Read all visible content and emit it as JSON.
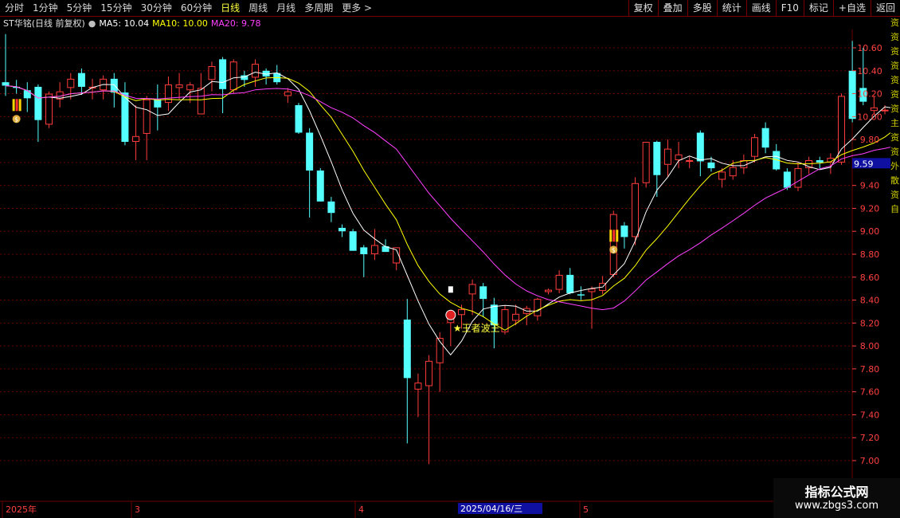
{
  "toolbar": {
    "left_items": [
      "分时",
      "1分钟",
      "5分钟",
      "15分钟",
      "30分钟",
      "60分钟",
      "日线",
      "周线",
      "月线",
      "多周期",
      "更多 >"
    ],
    "active_item": "日线",
    "right_items": [
      "复权",
      "叠加",
      "多股",
      "统计",
      "画线",
      "F10",
      "标记",
      "+自选",
      "返回"
    ]
  },
  "info": {
    "title": "ST华铭(日线 前复权)",
    "ma5": "MA5: 10.04",
    "ma10": "MA10: 10.00",
    "ma20": "MA20: 9.78"
  },
  "colors": {
    "up": "#ff3c3c",
    "down": "#54ffff",
    "ma5": "#ffffff",
    "ma10": "#ffff00",
    "ma20": "#ff40ff",
    "grid": "#6a0000",
    "axis_text": "#ff4040",
    "price_box": "#1010a0"
  },
  "price_axis": {
    "ticks": [
      "10.60",
      "10.40",
      "10.20",
      "10.00",
      "9.80",
      "9.60",
      "9.40",
      "9.20",
      "9.00",
      "8.80",
      "8.60",
      "8.40",
      "8.20",
      "8.00",
      "7.80",
      "7.60",
      "7.40",
      "7.20",
      "7.00"
    ],
    "current_price": "9.59"
  },
  "date_axis": {
    "labels": [
      "2025年",
      "3",
      "4",
      "5"
    ],
    "cursor_date": "2025/04/16/三"
  },
  "annotations": {
    "signal_text": "★王者波王"
  },
  "side_labels": [
    "资",
    "资",
    "资",
    "资",
    "资",
    "资",
    "资",
    "主",
    "资",
    "资",
    "外",
    "散",
    "资",
    "自"
  ],
  "watermark": {
    "line1": "指标公式网",
    "line2": "www.zbgs3.com"
  },
  "chart_data": {
    "type": "candlestick",
    "ylim": [
      6.92,
      10.95
    ],
    "candles": [
      {
        "o": 10.3,
        "h": 10.72,
        "l": 10.18,
        "c": 10.27
      },
      {
        "o": 10.26,
        "h": 10.32,
        "l": 10.2,
        "c": 10.25
      },
      {
        "o": 10.23,
        "h": 10.3,
        "l": 10.04,
        "c": 10.16
      },
      {
        "o": 10.26,
        "h": 10.28,
        "l": 9.78,
        "c": 9.97
      },
      {
        "o": 9.93,
        "h": 10.22,
        "l": 9.9,
        "c": 10.2
      },
      {
        "o": 10.15,
        "h": 10.3,
        "l": 10.08,
        "c": 10.22
      },
      {
        "o": 10.25,
        "h": 10.38,
        "l": 10.15,
        "c": 10.33
      },
      {
        "o": 10.38,
        "h": 10.42,
        "l": 10.19,
        "c": 10.26
      },
      {
        "o": 10.25,
        "h": 10.33,
        "l": 10.15,
        "c": 10.26
      },
      {
        "o": 10.23,
        "h": 10.36,
        "l": 10.15,
        "c": 10.33
      },
      {
        "o": 10.33,
        "h": 10.38,
        "l": 10.08,
        "c": 10.21
      },
      {
        "o": 10.21,
        "h": 10.3,
        "l": 9.75,
        "c": 9.78
      },
      {
        "o": 9.78,
        "h": 10.1,
        "l": 9.62,
        "c": 9.83
      },
      {
        "o": 9.85,
        "h": 10.18,
        "l": 9.62,
        "c": 10.15
      },
      {
        "o": 10.15,
        "h": 10.28,
        "l": 9.88,
        "c": 10.08
      },
      {
        "o": 10.12,
        "h": 10.35,
        "l": 10.05,
        "c": 10.28
      },
      {
        "o": 10.25,
        "h": 10.38,
        "l": 10.15,
        "c": 10.28
      },
      {
        "o": 10.23,
        "h": 10.3,
        "l": 10.12,
        "c": 10.28
      },
      {
        "o": 10.02,
        "h": 10.38,
        "l": 10.02,
        "c": 10.25
      },
      {
        "o": 10.32,
        "h": 10.48,
        "l": 10.22,
        "c": 10.44
      },
      {
        "o": 10.5,
        "h": 10.52,
        "l": 10.03,
        "c": 10.24
      },
      {
        "o": 10.23,
        "h": 10.5,
        "l": 10.2,
        "c": 10.48
      },
      {
        "o": 10.36,
        "h": 10.4,
        "l": 10.26,
        "c": 10.32
      },
      {
        "o": 10.34,
        "h": 10.5,
        "l": 10.26,
        "c": 10.46
      },
      {
        "o": 10.4,
        "h": 10.42,
        "l": 10.28,
        "c": 10.35
      },
      {
        "o": 10.38,
        "h": 10.45,
        "l": 10.28,
        "c": 10.3
      },
      {
        "o": 10.18,
        "h": 10.25,
        "l": 10.12,
        "c": 10.22
      },
      {
        "o": 10.1,
        "h": 10.12,
        "l": 9.85,
        "c": 9.86
      },
      {
        "o": 9.86,
        "h": 9.9,
        "l": 9.12,
        "c": 9.53
      },
      {
        "o": 9.53,
        "h": 9.55,
        "l": 9.26,
        "c": 9.26
      },
      {
        "o": 9.26,
        "h": 9.3,
        "l": 9.08,
        "c": 9.16
      },
      {
        "o": 9.03,
        "h": 9.06,
        "l": 8.95,
        "c": 9.0
      },
      {
        "o": 9.0,
        "h": 9.02,
        "l": 8.83,
        "c": 8.83
      },
      {
        "o": 8.86,
        "h": 8.88,
        "l": 8.6,
        "c": 8.8
      },
      {
        "o": 8.8,
        "h": 9.02,
        "l": 8.75,
        "c": 8.88
      },
      {
        "o": 8.87,
        "h": 8.93,
        "l": 8.82,
        "c": 8.82
      },
      {
        "o": 8.72,
        "h": 8.86,
        "l": 8.66,
        "c": 8.86
      },
      {
        "o": 8.23,
        "h": 8.41,
        "l": 7.15,
        "c": 7.72
      },
      {
        "o": 7.62,
        "h": 7.76,
        "l": 7.38,
        "c": 7.68
      },
      {
        "o": 7.65,
        "h": 7.92,
        "l": 6.97,
        "c": 7.87
      },
      {
        "o": 7.85,
        "h": 8.12,
        "l": 7.6,
        "c": 8.07
      },
      {
        "o": 8.2,
        "h": 8.29,
        "l": 8.0,
        "c": 8.27
      },
      {
        "o": 8.27,
        "h": 8.36,
        "l": 8.15,
        "c": 8.32
      },
      {
        "o": 8.45,
        "h": 8.58,
        "l": 8.27,
        "c": 8.54
      },
      {
        "o": 8.52,
        "h": 8.55,
        "l": 8.25,
        "c": 8.41
      },
      {
        "o": 8.36,
        "h": 8.42,
        "l": 7.98,
        "c": 8.18
      },
      {
        "o": 8.12,
        "h": 8.35,
        "l": 8.1,
        "c": 8.32
      },
      {
        "o": 8.22,
        "h": 8.36,
        "l": 8.18,
        "c": 8.28
      },
      {
        "o": 8.28,
        "h": 8.35,
        "l": 8.18,
        "c": 8.33
      },
      {
        "o": 8.26,
        "h": 8.42,
        "l": 8.22,
        "c": 8.41
      },
      {
        "o": 8.47,
        "h": 8.5,
        "l": 8.45,
        "c": 8.49
      },
      {
        "o": 8.49,
        "h": 8.66,
        "l": 8.46,
        "c": 8.62
      },
      {
        "o": 8.62,
        "h": 8.68,
        "l": 8.45,
        "c": 8.46
      },
      {
        "o": 8.45,
        "h": 8.52,
        "l": 8.4,
        "c": 8.44
      },
      {
        "o": 8.47,
        "h": 8.52,
        "l": 8.15,
        "c": 8.5
      },
      {
        "o": 8.48,
        "h": 8.61,
        "l": 8.45,
        "c": 8.55
      },
      {
        "o": 8.62,
        "h": 9.18,
        "l": 8.6,
        "c": 9.15
      },
      {
        "o": 9.05,
        "h": 9.08,
        "l": 8.85,
        "c": 8.95
      },
      {
        "o": 8.95,
        "h": 9.47,
        "l": 8.88,
        "c": 9.42
      },
      {
        "o": 9.42,
        "h": 9.78,
        "l": 9.38,
        "c": 9.78
      },
      {
        "o": 9.78,
        "h": 9.79,
        "l": 9.3,
        "c": 9.49
      },
      {
        "o": 9.58,
        "h": 9.8,
        "l": 9.48,
        "c": 9.72
      },
      {
        "o": 9.62,
        "h": 9.78,
        "l": 9.55,
        "c": 9.67
      },
      {
        "o": 9.62,
        "h": 9.65,
        "l": 9.55,
        "c": 9.62
      },
      {
        "o": 9.86,
        "h": 9.88,
        "l": 9.48,
        "c": 9.61
      },
      {
        "o": 9.6,
        "h": 9.65,
        "l": 9.52,
        "c": 9.55
      },
      {
        "o": 9.45,
        "h": 9.55,
        "l": 9.38,
        "c": 9.52
      },
      {
        "o": 9.48,
        "h": 9.62,
        "l": 9.45,
        "c": 9.56
      },
      {
        "o": 9.55,
        "h": 9.67,
        "l": 9.5,
        "c": 9.62
      },
      {
        "o": 9.65,
        "h": 9.85,
        "l": 9.6,
        "c": 9.82
      },
      {
        "o": 9.9,
        "h": 9.95,
        "l": 9.68,
        "c": 9.73
      },
      {
        "o": 9.7,
        "h": 9.76,
        "l": 9.53,
        "c": 9.54
      },
      {
        "o": 9.52,
        "h": 9.55,
        "l": 9.36,
        "c": 9.38
      },
      {
        "o": 9.38,
        "h": 9.6,
        "l": 9.35,
        "c": 9.55
      },
      {
        "o": 9.55,
        "h": 9.65,
        "l": 9.5,
        "c": 9.62
      },
      {
        "o": 9.62,
        "h": 9.65,
        "l": 9.55,
        "c": 9.6
      },
      {
        "o": 9.6,
        "h": 9.68,
        "l": 9.5,
        "c": 9.64
      },
      {
        "o": 9.6,
        "h": 10.2,
        "l": 9.58,
        "c": 10.18
      },
      {
        "o": 10.4,
        "h": 10.66,
        "l": 9.95,
        "c": 9.98
      },
      {
        "o": 10.25,
        "h": 10.6,
        "l": 10.1,
        "c": 10.13
      },
      {
        "o": 10.05,
        "h": 10.18,
        "l": 10.02,
        "c": 10.08
      },
      {
        "o": 10.05,
        "h": 10.1,
        "l": 10.02,
        "c": 10.06
      },
      {
        "o": 10.05,
        "h": 10.16,
        "l": 10.0,
        "c": 10.1
      },
      {
        "o": 10.15,
        "h": 10.2,
        "l": 10.08,
        "c": 10.1
      },
      {
        "o": 10.13,
        "h": 10.18,
        "l": 9.95,
        "c": 10.0
      },
      {
        "o": 9.95,
        "h": 10.12,
        "l": 9.85,
        "c": 10.04
      }
    ]
  }
}
